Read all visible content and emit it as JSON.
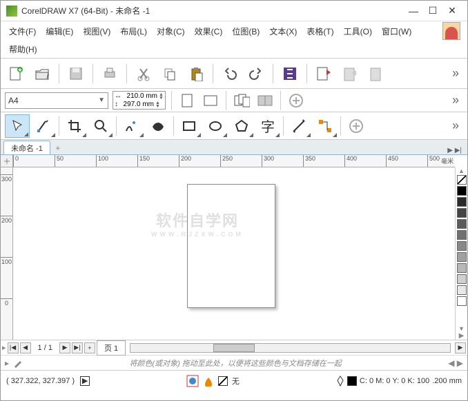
{
  "title": "CorelDRAW X7 (64-Bit) - 未命名 -1",
  "menu": {
    "file": "文件(F)",
    "edit": "编辑(E)",
    "view": "视图(V)",
    "layout": "布局(L)",
    "object": "对象(C)",
    "effect": "效果(C)",
    "bitmap": "位图(B)",
    "text": "文本(X)",
    "table": "表格(T)",
    "tools": "工具(O)",
    "window": "窗口(W)",
    "help": "帮助(H)"
  },
  "properties": {
    "paper": "A4",
    "width": "210.0 mm",
    "height": "297.0 mm"
  },
  "doc_tab": "未命名 -1",
  "ruler_unit": "毫米",
  "h_ticks": [
    "0",
    "50",
    "100",
    "150",
    "200",
    "250",
    "300",
    "350",
    "400",
    "450",
    "500"
  ],
  "v_ticks": [
    "0",
    "100",
    "200",
    "300"
  ],
  "pagenav": {
    "pages": "1 / 1",
    "page_tab": "页 1"
  },
  "color_hint": "将颜色(或对象) 拖动至此处，以便将这些颜色与文档存储在一起",
  "status": {
    "coords": "( 327.322, 327.397 )",
    "fill_label": "无",
    "cmyk": "C: 0 M: 0 Y: 0 K: 100",
    "outline": ".200 mm"
  },
  "watermark": {
    "main": "软件自学网",
    "sub": "WWW.RJZXW.COM"
  },
  "chart_data": {
    "type": "table",
    "note": "no chart in image"
  }
}
